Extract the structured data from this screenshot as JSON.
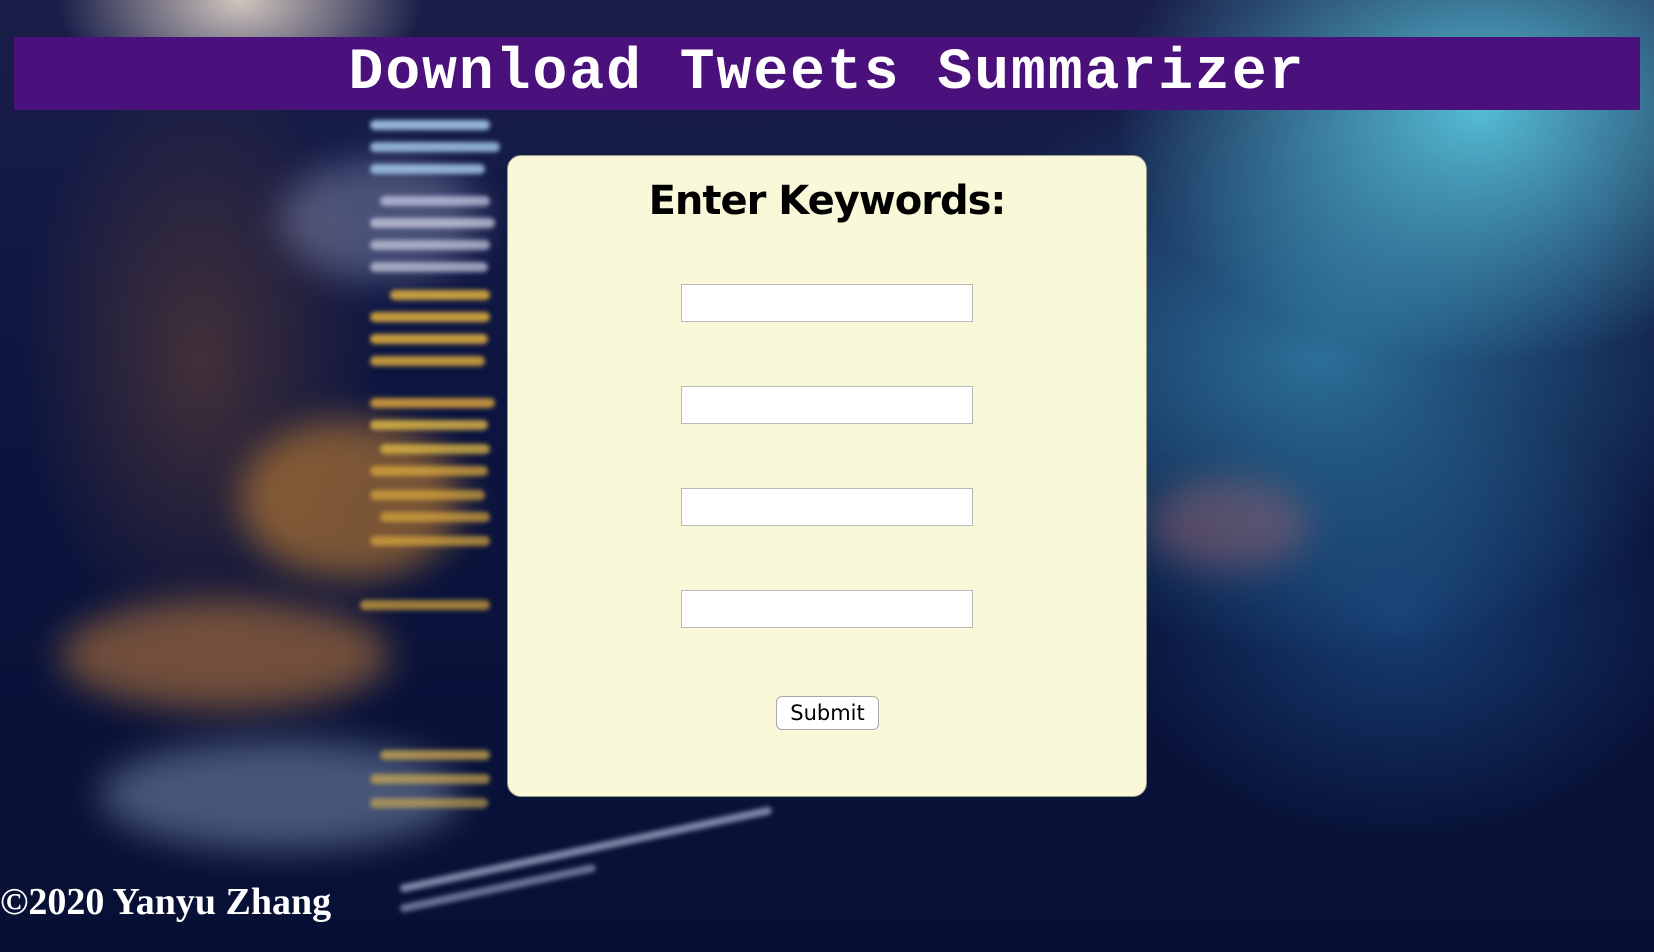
{
  "header": {
    "title": "Download Tweets Summarizer"
  },
  "form": {
    "heading": "Enter Keywords:",
    "inputs": [
      {
        "value": "",
        "placeholder": ""
      },
      {
        "value": "",
        "placeholder": ""
      },
      {
        "value": "",
        "placeholder": ""
      },
      {
        "value": "",
        "placeholder": ""
      }
    ],
    "submit_label": "Submit"
  },
  "footer": {
    "copyright": "©2020 Yanyu Zhang"
  },
  "colors": {
    "header_bg": "#4a107c",
    "card_bg": "#f9f8d9"
  }
}
